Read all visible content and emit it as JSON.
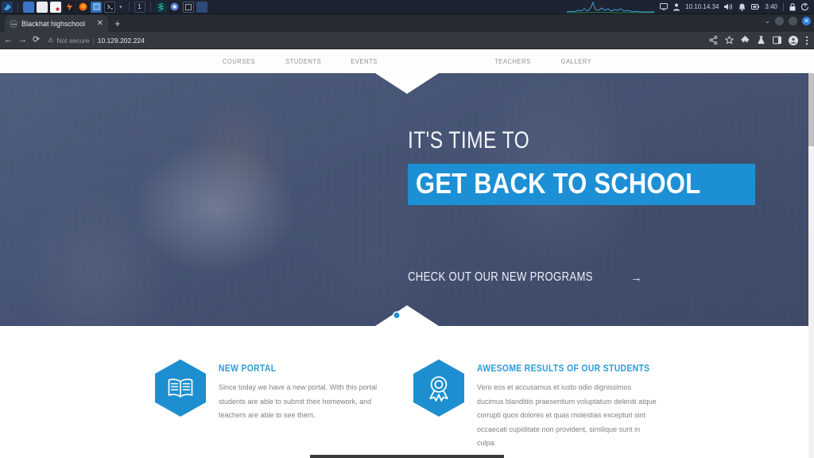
{
  "taskbar": {
    "apps": [
      {
        "name": "app-launcher-icon",
        "glyph": "❖",
        "color": "#2a6fb5"
      },
      {
        "name": "terminal-icon",
        "glyph": "",
        "color": "#3a74c4"
      },
      {
        "name": "file-manager-icon",
        "glyph": "",
        "color": "#e9edf2"
      },
      {
        "name": "pdf-reader-icon",
        "glyph": "",
        "color": "#f4f6f8"
      },
      {
        "name": "burp-suite-icon",
        "glyph": "",
        "color": "#f0741f"
      },
      {
        "name": "firefox-icon",
        "glyph": "",
        "color": "#e8661a"
      },
      {
        "name": "window-tile-icon",
        "glyph": "",
        "color": "#4a8fd4"
      },
      {
        "name": "shell-icon",
        "glyph": "▣",
        "color": "#1c2029"
      }
    ],
    "workspace": "1",
    "apps_right": [
      {
        "name": "sublime-icon",
        "glyph": "",
        "color": "#2bb7a8"
      },
      {
        "name": "chromium-icon",
        "glyph": "",
        "color": "#5b7fd4"
      },
      {
        "name": "terminal-window-icon",
        "glyph": "▣",
        "color": "#242935"
      },
      {
        "name": "misc-icon",
        "glyph": "",
        "color": "#2d4a78"
      }
    ],
    "tray": {
      "display_icon": "display-icon",
      "vpn_icon": "vpn-icon",
      "ip_address": "10.10.14.34",
      "volume_icon": "volume-icon",
      "bell_icon": "notifications-icon",
      "battery_icon": "battery-icon",
      "time": "3:40",
      "lock_icon": "lock-icon",
      "power_icon": "power-icon"
    }
  },
  "browser": {
    "tab": {
      "title": "Blackhat highschool",
      "close_label": "✕"
    },
    "new_tab_label": "+",
    "window_controls": {
      "caret": "⌄",
      "minimize": "minimize",
      "maximize": "maximize",
      "close": "✕"
    },
    "toolbar": {
      "back": "←",
      "forward": "→",
      "reload": "⟳",
      "security_icon": "⚠",
      "security_text": "Not secure",
      "divider": "|",
      "url": "10.129.202.224",
      "icons": [
        "share-icon",
        "bookmark-star-icon",
        "extensions-puzzle-icon",
        "lab-beaker-icon",
        "sidebar-panel-icon",
        "profile-avatar-icon",
        "three-dot-menu-icon"
      ]
    }
  },
  "site": {
    "nav": {
      "left": [
        "COURSES",
        "STUDENTS",
        "EVENTS"
      ],
      "right": [
        "TEACHERS",
        "GALLERY"
      ]
    },
    "hero": {
      "kicker": "IT'S TIME TO",
      "headline": "GET BACK TO SCHOOL",
      "cta_text": "CHECK OUT OUR NEW PROGRAMS",
      "cta_arrow": "→",
      "highlight_color": "#1c8fd5",
      "slides": 3,
      "active_slide": 1
    },
    "features": [
      {
        "icon": "open-book-icon",
        "title": "NEW PORTAL",
        "text": "Since today we have a new portal. With this portal students are able to submit their homework, and teachers are able to see them."
      },
      {
        "icon": "award-ribbon-icon",
        "title": "AWESOME RESULTS OF OUR STUDENTS",
        "text": "Vero eos et accusamus et iusto odio dignissimos ducimus blanditiis praesentium voluptatum deleniti atque corrupti quos dolores et quas molestias excepturi sint occaecati cupiditate non provident, similique sunt in culpa."
      }
    ]
  }
}
